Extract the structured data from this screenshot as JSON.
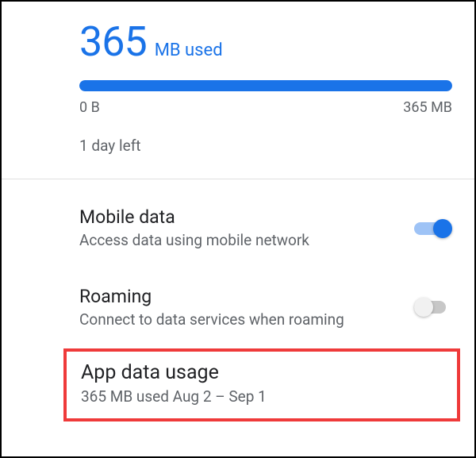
{
  "usage": {
    "amount": "365",
    "unit_label": "MB used",
    "progress_percent": 100,
    "min_label": "0 B",
    "max_label": "365 MB",
    "days_left": "1 day left"
  },
  "settings": {
    "mobile_data": {
      "title": "Mobile data",
      "subtitle": "Access data using mobile network",
      "on": true
    },
    "roaming": {
      "title": "Roaming",
      "subtitle": "Connect to data services when roaming",
      "on": false
    },
    "app_data_usage": {
      "title": "App data usage",
      "subtitle": "365 MB used Aug 2 – Sep 1"
    }
  },
  "colors": {
    "accent": "#1a73e8",
    "highlight": "#ef3a3a"
  }
}
